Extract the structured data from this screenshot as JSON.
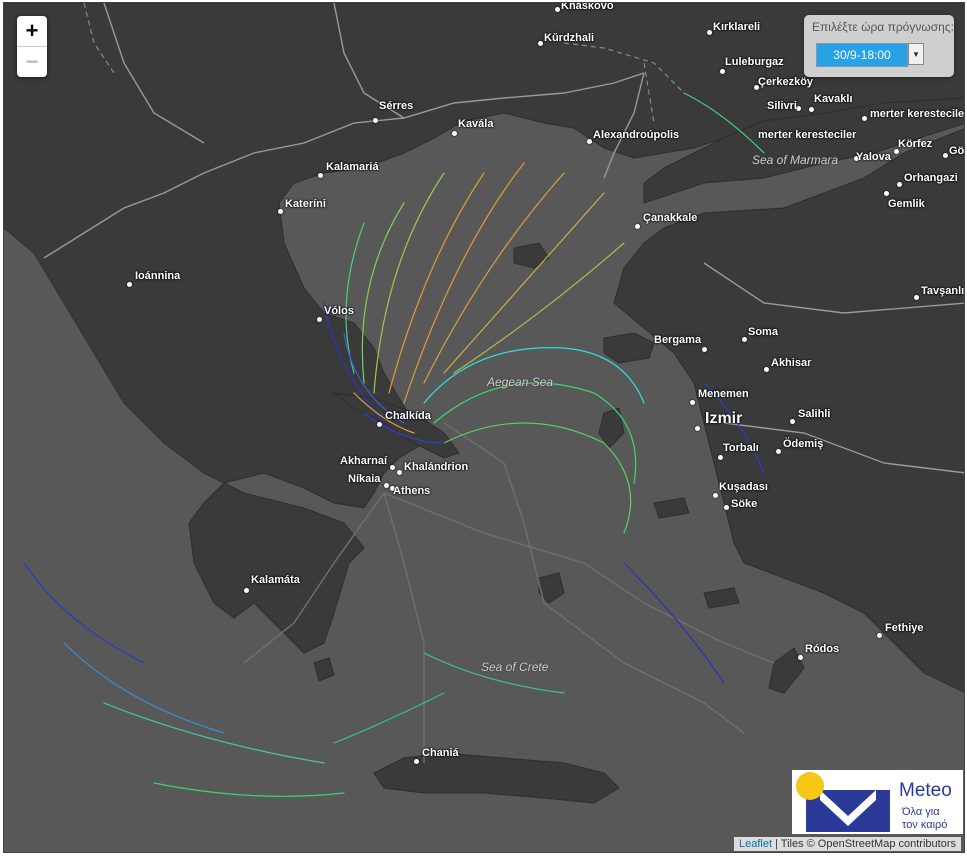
{
  "zoom": {
    "in_label": "+",
    "out_label": "−"
  },
  "forecast_picker": {
    "label": "Επιλέξτε ώρα πρόγνωσης:",
    "selected": "30/9-18:00",
    "arrow": "▾"
  },
  "places": [
    {
      "name": "Khaskovo"
    },
    {
      "name": "Kırklareli"
    },
    {
      "name": "Kŭrdzhali"
    },
    {
      "name": "Luleburgaz"
    },
    {
      "name": "Çerkezköy"
    },
    {
      "name": "Silivri"
    },
    {
      "name": "Kavaklı"
    },
    {
      "name": "merter keresteciler"
    },
    {
      "name": "merter keresteciler"
    },
    {
      "name": "Körfez"
    },
    {
      "name": "Gö"
    },
    {
      "name": "Yalova"
    },
    {
      "name": "Orhangazi"
    },
    {
      "name": "Gemlik"
    },
    {
      "name": "Sérres"
    },
    {
      "name": "Kavála"
    },
    {
      "name": "Alexandroúpolis"
    },
    {
      "name": "Kalamariá"
    },
    {
      "name": "Kateríni"
    },
    {
      "name": "Çanakkale"
    },
    {
      "name": "Ioánnina"
    },
    {
      "name": "Tavşanlı"
    },
    {
      "name": "Vólos"
    },
    {
      "name": "Soma"
    },
    {
      "name": "Bergama"
    },
    {
      "name": "Akhisar"
    },
    {
      "name": "Menemen"
    },
    {
      "name": "Izmir"
    },
    {
      "name": "Salihli"
    },
    {
      "name": "Chalkída"
    },
    {
      "name": "Torbalı"
    },
    {
      "name": "Ödemiş"
    },
    {
      "name": "Akharnaí"
    },
    {
      "name": "Khalándrion"
    },
    {
      "name": "Níkaia"
    },
    {
      "name": "Athens"
    },
    {
      "name": "Kuşadası"
    },
    {
      "name": "Söke"
    },
    {
      "name": "Kalamáta"
    },
    {
      "name": "Fethiye"
    },
    {
      "name": "Ródos"
    },
    {
      "name": "Chaniá"
    }
  ],
  "seas": [
    {
      "name": "Sea of Marmara"
    },
    {
      "name": "Aegean Sea"
    },
    {
      "name": "Sea of Crete"
    }
  ],
  "logo": {
    "brand": "Meteo",
    "tagline1": "Όλα για",
    "tagline2": "τον καιρό"
  },
  "attribution": {
    "leaflet": "Leaflet",
    "rest": " | Tiles © OpenStreetMap contributors"
  }
}
